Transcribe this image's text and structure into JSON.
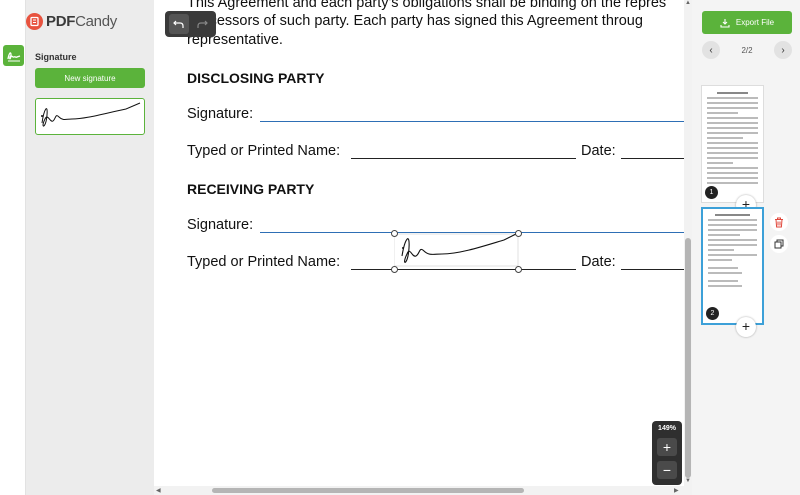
{
  "app": {
    "logo_pdf": "PDF",
    "logo_candy": "Candy"
  },
  "left_panel": {
    "title": "Signature",
    "new_signature_label": "New signature"
  },
  "document": {
    "line1": "This Agreement and each party's obligations shall be binding on the repres",
    "line2": "successors of such party. Each party has signed this Agreement throug",
    "line3": "representative.",
    "disclosing_heading": "DISCLOSING PARTY",
    "signature_label_1": "Signature:",
    "name_label_1": "Typed or Printed Name:",
    "date_label_1": "Date:",
    "receiving_heading": "RECEIVING PARTY",
    "signature_label_2": "Signature:",
    "name_label_2": "Typed or Printed Name:",
    "date_label_2": "Date:"
  },
  "zoom": {
    "level": "149%",
    "plus": "+",
    "minus": "−"
  },
  "right_panel": {
    "export_label": "Export File",
    "page_count": "2/2",
    "prev": "‹",
    "next": "›",
    "pages": [
      {
        "number": "1"
      },
      {
        "number": "2"
      }
    ],
    "add_page": "+"
  },
  "colors": {
    "accent": "#5bb33b",
    "brand": "#e8533f",
    "selection": "#3ca0d8"
  }
}
